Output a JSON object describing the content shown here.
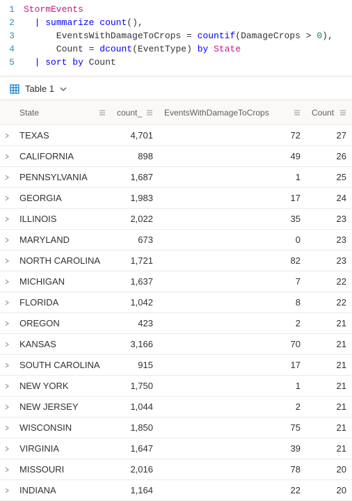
{
  "editor": {
    "lines": [
      {
        "n": 1,
        "tokens": [
          {
            "t": "StormEvents",
            "c": "tok-table"
          }
        ]
      },
      {
        "n": 2,
        "tokens": [
          {
            "t": "  ",
            "c": "tok-plain"
          },
          {
            "t": "|",
            "c": "tok-pipe"
          },
          {
            "t": " ",
            "c": "tok-plain"
          },
          {
            "t": "summarize",
            "c": "tok-op"
          },
          {
            "t": " ",
            "c": "tok-plain"
          },
          {
            "t": "count",
            "c": "tok-func"
          },
          {
            "t": "(),",
            "c": "tok-plain"
          }
        ]
      },
      {
        "n": 3,
        "tokens": [
          {
            "t": "      EventsWithDamageToCrops ",
            "c": "tok-plain"
          },
          {
            "t": "=",
            "c": "tok-plain"
          },
          {
            "t": " ",
            "c": "tok-plain"
          },
          {
            "t": "countif",
            "c": "tok-func"
          },
          {
            "t": "(DamageCrops ",
            "c": "tok-plain"
          },
          {
            "t": ">",
            "c": "tok-plain"
          },
          {
            "t": " ",
            "c": "tok-plain"
          },
          {
            "t": "0",
            "c": "tok-num"
          },
          {
            "t": "),",
            "c": "tok-plain"
          }
        ]
      },
      {
        "n": 4,
        "tokens": [
          {
            "t": "      Count ",
            "c": "tok-plain"
          },
          {
            "t": "=",
            "c": "tok-plain"
          },
          {
            "t": " ",
            "c": "tok-plain"
          },
          {
            "t": "dcount",
            "c": "tok-func"
          },
          {
            "t": "(EventType) ",
            "c": "tok-plain"
          },
          {
            "t": "by",
            "c": "tok-kw"
          },
          {
            "t": " ",
            "c": "tok-plain"
          },
          {
            "t": "State",
            "c": "tok-col"
          }
        ]
      },
      {
        "n": 5,
        "tokens": [
          {
            "t": "  ",
            "c": "tok-plain"
          },
          {
            "t": "|",
            "c": "tok-pipe"
          },
          {
            "t": " ",
            "c": "tok-plain"
          },
          {
            "t": "sort",
            "c": "tok-op"
          },
          {
            "t": " ",
            "c": "tok-plain"
          },
          {
            "t": "by",
            "c": "tok-kw"
          },
          {
            "t": " Count",
            "c": "tok-plain"
          }
        ]
      }
    ]
  },
  "tab": {
    "label": "Table 1"
  },
  "columns": {
    "state": "State",
    "count_": "count_",
    "dmg": "EventsWithDamageToCrops",
    "count": "Count"
  },
  "rows": [
    {
      "state": "TEXAS",
      "count_": "4,701",
      "dmg": "72",
      "count": "27"
    },
    {
      "state": "CALIFORNIA",
      "count_": "898",
      "dmg": "49",
      "count": "26"
    },
    {
      "state": "PENNSYLVANIA",
      "count_": "1,687",
      "dmg": "1",
      "count": "25"
    },
    {
      "state": "GEORGIA",
      "count_": "1,983",
      "dmg": "17",
      "count": "24"
    },
    {
      "state": "ILLINOIS",
      "count_": "2,022",
      "dmg": "35",
      "count": "23"
    },
    {
      "state": "MARYLAND",
      "count_": "673",
      "dmg": "0",
      "count": "23"
    },
    {
      "state": "NORTH CAROLINA",
      "count_": "1,721",
      "dmg": "82",
      "count": "23"
    },
    {
      "state": "MICHIGAN",
      "count_": "1,637",
      "dmg": "7",
      "count": "22"
    },
    {
      "state": "FLORIDA",
      "count_": "1,042",
      "dmg": "8",
      "count": "22"
    },
    {
      "state": "OREGON",
      "count_": "423",
      "dmg": "2",
      "count": "21"
    },
    {
      "state": "KANSAS",
      "count_": "3,166",
      "dmg": "70",
      "count": "21"
    },
    {
      "state": "SOUTH CAROLINA",
      "count_": "915",
      "dmg": "17",
      "count": "21"
    },
    {
      "state": "NEW YORK",
      "count_": "1,750",
      "dmg": "1",
      "count": "21"
    },
    {
      "state": "NEW JERSEY",
      "count_": "1,044",
      "dmg": "2",
      "count": "21"
    },
    {
      "state": "WISCONSIN",
      "count_": "1,850",
      "dmg": "75",
      "count": "21"
    },
    {
      "state": "VIRGINIA",
      "count_": "1,647",
      "dmg": "39",
      "count": "21"
    },
    {
      "state": "MISSOURI",
      "count_": "2,016",
      "dmg": "78",
      "count": "20"
    },
    {
      "state": "INDIANA",
      "count_": "1,164",
      "dmg": "22",
      "count": "20"
    }
  ]
}
